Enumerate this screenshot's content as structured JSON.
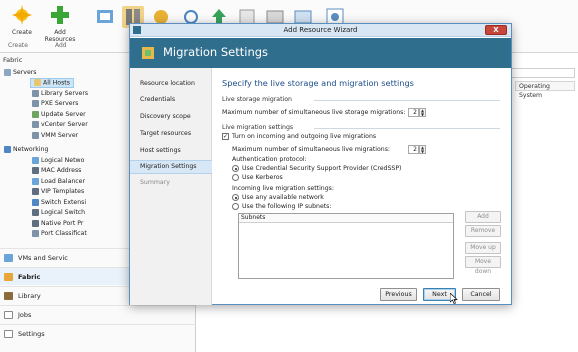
{
  "ribbon": {
    "buttons": [
      {
        "label": "Create"
      },
      {
        "label": "Add\nResources"
      }
    ],
    "groups": [
      {
        "label": "Create"
      },
      {
        "label": "Add"
      }
    ]
  },
  "nav": {
    "section_title": "Fabric",
    "tree": [
      {
        "label": "Servers"
      },
      {
        "label": "All Hosts"
      },
      {
        "label": "Library Servers"
      },
      {
        "label": "PXE Servers"
      },
      {
        "label": "Update Server"
      },
      {
        "label": "vCenter Server"
      },
      {
        "label": "VMM Server"
      },
      {
        "label": "Networking"
      },
      {
        "label": "Logical Netwo"
      },
      {
        "label": "MAC Address"
      },
      {
        "label": "Load Balancer"
      },
      {
        "label": "VIP Templates"
      },
      {
        "label": "Switch Extensi"
      },
      {
        "label": "Logical Switch"
      },
      {
        "label": "Native Port Pr"
      },
      {
        "label": "Port Classificat"
      }
    ],
    "workspaces": [
      {
        "label": "VMs and Servic"
      },
      {
        "label": "Fabric"
      },
      {
        "label": "Library"
      },
      {
        "label": "Jobs"
      },
      {
        "label": "Settings"
      }
    ]
  },
  "main": {
    "column_header": "Operating System"
  },
  "wizard": {
    "window_title": "Add Resource Wizard",
    "close_label": "X",
    "page_title": "Migration Settings",
    "steps": [
      {
        "label": "Resource location"
      },
      {
        "label": "Credentials"
      },
      {
        "label": "Discovery scope"
      },
      {
        "label": "Target resources"
      },
      {
        "label": "Host settings"
      },
      {
        "label": "Migration Settings"
      },
      {
        "label": "Summary"
      }
    ],
    "heading": "Specify the live storage and migration settings",
    "live_storage": {
      "section_label": "Live storage migration",
      "max_label": "Maximum number of simultaneous live storage migrations:",
      "max_value": "2"
    },
    "live_migration": {
      "section_label": "Live migration settings",
      "enable_label": "Turn on incoming and outgoing live migrations",
      "enable_checked": true,
      "max_label": "Maximum number of simultaneous live migrations:",
      "max_value": "2",
      "auth_label": "Authentication protocol:",
      "auth_options": [
        {
          "label": "Use Credential Security Support Provider (CredSSP)",
          "selected": true
        },
        {
          "label": "Use Kerberos",
          "selected": false
        }
      ],
      "incoming_label": "Incoming live migration settings:",
      "incoming_options": [
        {
          "label": "Use any available network",
          "selected": true
        },
        {
          "label": "Use the following IP subnets:",
          "selected": false
        }
      ],
      "subnets_header": "Subnets"
    },
    "side_buttons": {
      "add": "Add",
      "remove": "Remove",
      "move_up": "Move up",
      "move_down": "Move down"
    },
    "footer": {
      "previous": "Previous",
      "next": "Next",
      "cancel": "Cancel"
    }
  },
  "colors": {
    "header_bg": "#2f6e8c",
    "heading_text": "#1e4f8a",
    "current_step_bg": "#d7e7f5",
    "close_button": "#c7463c"
  }
}
